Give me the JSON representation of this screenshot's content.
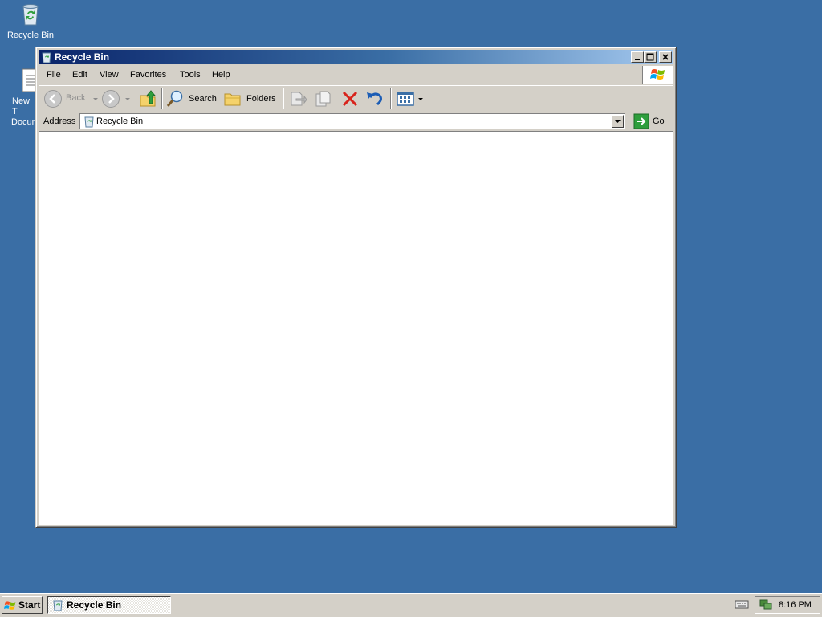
{
  "desktop": {
    "icons": [
      {
        "label": "Recycle Bin",
        "icon": "recycle-bin-icon"
      },
      {
        "label_line1": "New T",
        "label_line2": "Docum",
        "icon": "text-document-icon"
      }
    ]
  },
  "window": {
    "title": "Recycle Bin",
    "menu": [
      "File",
      "Edit",
      "View",
      "Favorites",
      "Tools",
      "Help"
    ],
    "toolbar": {
      "back_label": "Back",
      "search_label": "Search",
      "folders_label": "Folders"
    },
    "address": {
      "label": "Address",
      "value": "Recycle Bin",
      "go_label": "Go"
    }
  },
  "taskbar": {
    "start_label": "Start",
    "tasks": [
      {
        "label": "Recycle Bin"
      }
    ],
    "clock": "8:16 PM"
  },
  "colors": {
    "desktop": "#3a6ea5",
    "titlebar_start": "#0a246a",
    "titlebar_end": "#a6caf0",
    "chrome": "#d4d0c8"
  }
}
